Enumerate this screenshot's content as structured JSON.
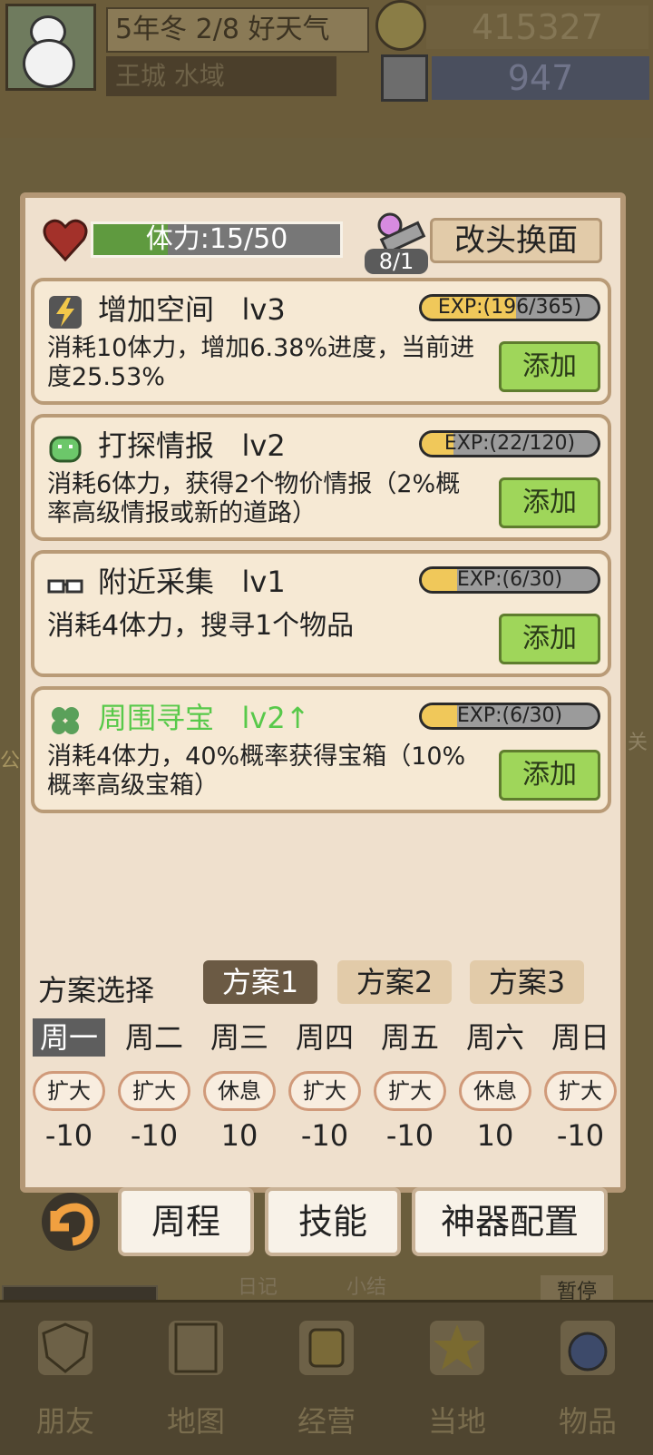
{
  "top": {
    "date_weather": "5年冬 2/8 好天气",
    "location": "王城 水域",
    "gold": "415327",
    "gems": "947"
  },
  "background": {
    "diary": "日记",
    "summary": "小结",
    "pause": "暂停",
    "left_text": "公",
    "right_text": "关"
  },
  "dialog": {
    "stamina_text": "体力:15/50",
    "stamina_fraction": 0.3,
    "scroll_count": "8/1",
    "makeover_label": "改头换面",
    "add_label": "添加",
    "skills": [
      {
        "name": "增加空间   lv3",
        "exp": "EXP:(196/365)",
        "exp_fraction": 0.537,
        "desc": "消耗10体力，增加6.38%进度，当前进度25.53%",
        "highlight": false,
        "icon": "lightning-icon"
      },
      {
        "name": "打探情报   lv2",
        "exp": "EXP:(22/120)",
        "exp_fraction": 0.18,
        "desc": "消耗6体力，获得2个物价情报（2%概率高级情报或新的道路）",
        "highlight": false,
        "icon": "slime-icon"
      },
      {
        "name": "附近采集   lv1",
        "exp": "EXP:(6/30)",
        "exp_fraction": 0.2,
        "desc": "消耗4体力，搜寻1个物品",
        "highlight": false,
        "icon": "glasses-icon"
      },
      {
        "name": "周围寻宝   lv2↑",
        "exp": "EXP:(6/30)",
        "exp_fraction": 0.2,
        "desc": "消耗4体力，40%概率获得宝箱（10%概率高级宝箱）",
        "highlight": true,
        "icon": "clover-icon"
      }
    ],
    "plan_label": "方案选择",
    "plans": [
      "方案1",
      "方案2",
      "方案3"
    ],
    "active_plan": 0,
    "days": [
      "周一",
      "周二",
      "周三",
      "周四",
      "周五",
      "周六",
      "周日"
    ],
    "active_day": 0,
    "activities": [
      "扩大",
      "扩大",
      "休息",
      "扩大",
      "扩大",
      "休息",
      "扩大"
    ],
    "values": [
      "-10",
      "-10",
      "10",
      "-10",
      "-10",
      "10",
      "-10"
    ]
  },
  "buttons": {
    "weekly": "周程",
    "skills": "技能",
    "artifact": "神器配置"
  },
  "nav": [
    "朋友",
    "地图",
    "经营",
    "当地",
    "物品"
  ],
  "colors": {
    "add_button": "#9fd65a",
    "highlight_text": "#58c94a",
    "stamina_fill": "#5f9a3f",
    "exp_fill": "#f0c85a"
  }
}
